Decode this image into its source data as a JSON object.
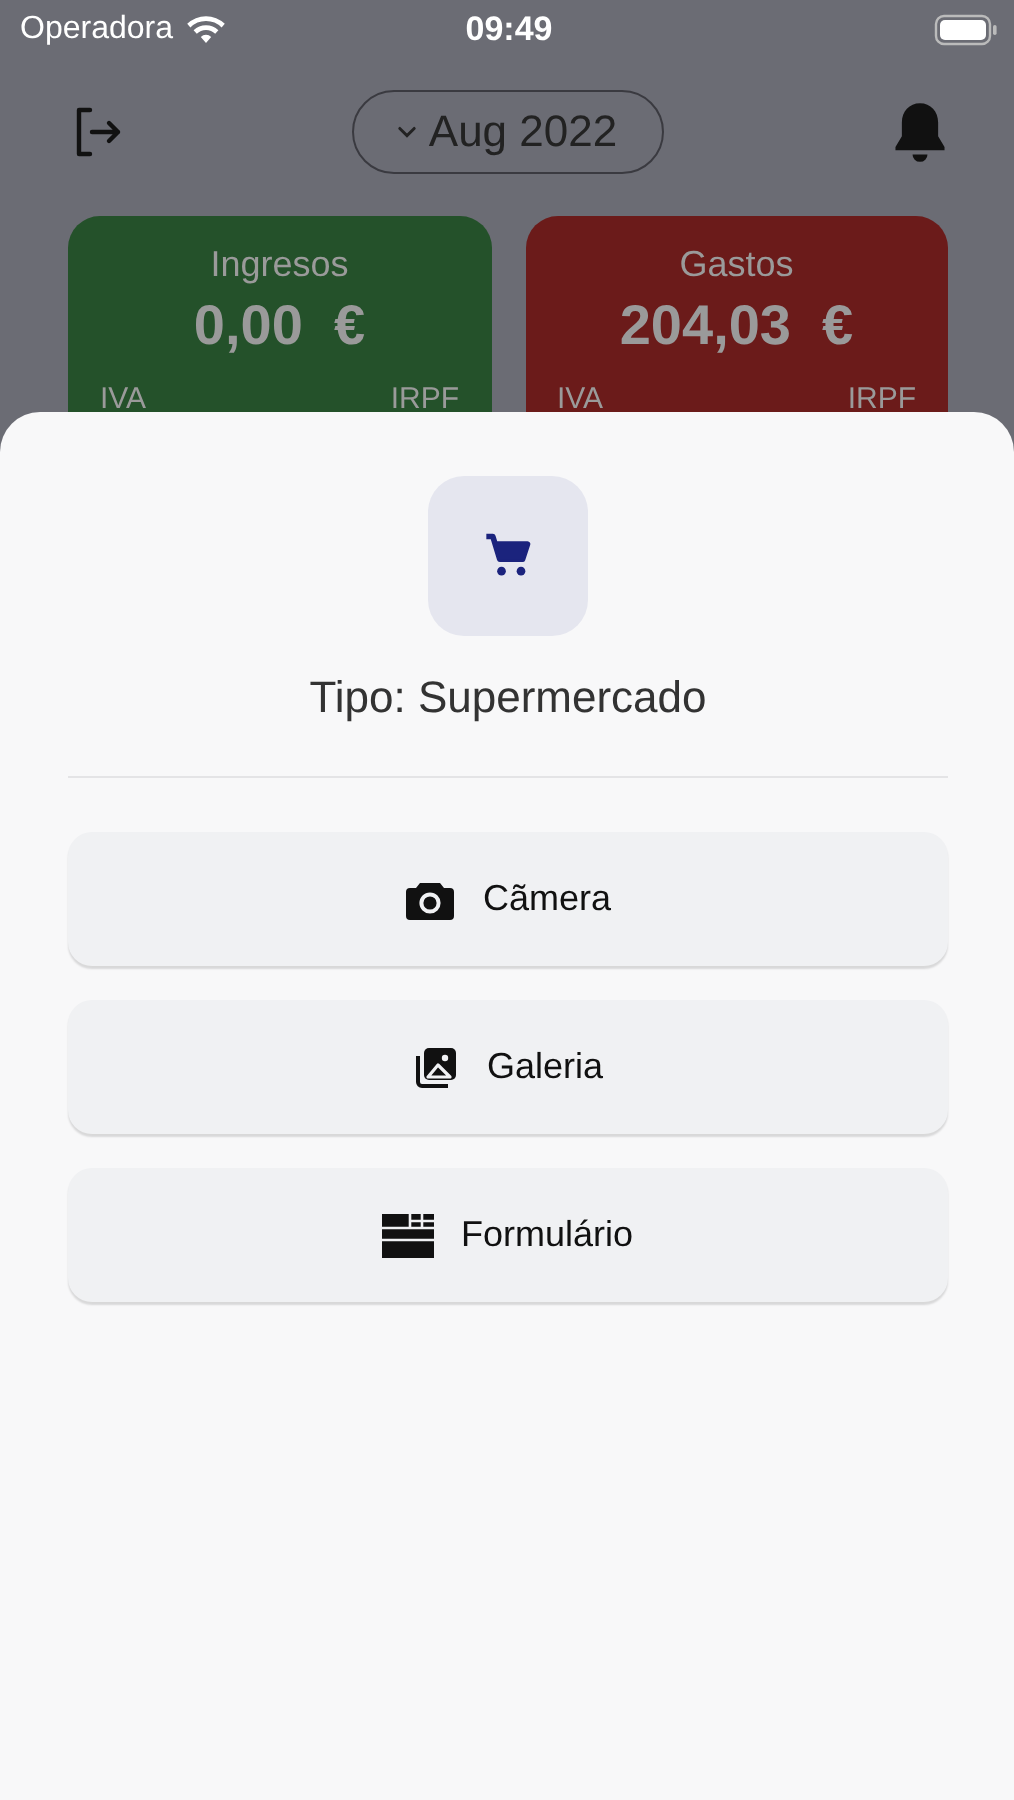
{
  "status_bar": {
    "carrier": "Operadora",
    "time": "09:49"
  },
  "header": {
    "month": "Aug 2022"
  },
  "summary_cards": [
    {
      "kind": "income",
      "title": "Ingresos",
      "amount": "0,00  €",
      "left_label": "IVA",
      "right_label": "IRPF"
    },
    {
      "kind": "expense",
      "title": "Gastos",
      "amount": "204,03  €",
      "left_label": "IVA",
      "right_label": "IRPF"
    }
  ],
  "sheet": {
    "type_label": "Tipo: Supermercado",
    "options": [
      {
        "kind": "camera",
        "label": "Cãmera"
      },
      {
        "kind": "gallery",
        "label": "Galeria"
      },
      {
        "kind": "form",
        "label": "Formulário"
      }
    ]
  }
}
